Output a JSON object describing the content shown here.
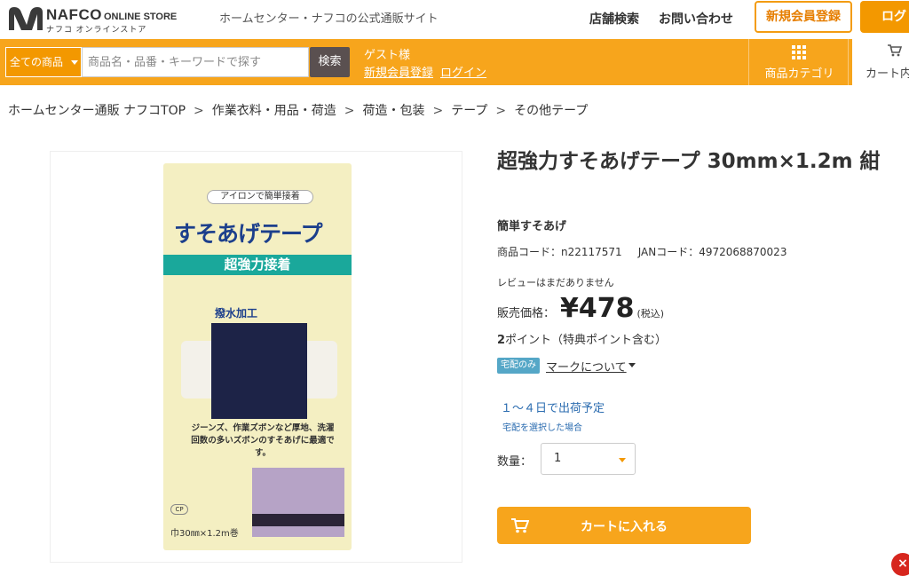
{
  "header": {
    "logo_name": "NAFCO",
    "logo_online": "ONLINE STORE",
    "logo_kana": "ナフコ オンラインストア",
    "tagline": "ホームセンター・ナフコの公式通販サイト",
    "store_search": "店舗検索",
    "contact": "お問い合わせ",
    "register": "新規会員登録",
    "login": "ログ"
  },
  "searchbar": {
    "category_select": "全ての商品",
    "placeholder": "商品名・品番・キーワードで探す",
    "search_button": "検索",
    "guest_label": "ゲスト様",
    "register_link": "新規会員登録",
    "login_link": "ログイン",
    "category_button": "商品カテゴリ",
    "cart_button": "カート内"
  },
  "breadcrumb": [
    "ホームセンター通販 ナフコTOP",
    "作業衣料・用品・荷造",
    "荷造・包装",
    "テープ",
    "その他テープ"
  ],
  "breadcrumb_sep": ">",
  "product_image": {
    "top_label": "アイロンで簡単接着",
    "name": "すそあげテープ",
    "band": "超強力接着",
    "water": "撥水加工",
    "desc": "ジーンズ、作業ズボンなど厚地、洗濯回数の多いズボンのすそあげに最適です。",
    "size": "巾30㎜×1.2m巻",
    "small_logo": "CP"
  },
  "product": {
    "title": "超強力すそあげテープ 30mm×1.2m 紺",
    "subtitle": "簡単すそあげ",
    "code": "商品コード：n22117571",
    "jan": "JANコード：4972068870023",
    "review": "レビューはまだありません",
    "price_label": "販売価格：",
    "price": "¥478",
    "tax": "(税込)",
    "points_num": "2",
    "points_text": "ポイント（特典ポイント含む）",
    "badge": "宅配のみ",
    "mark_link": "マークについて",
    "ship": "１～４日で出荷予定",
    "ship_note": "宅配を選択した場合",
    "qty_label": "数量：",
    "qty_value": "1",
    "add_to_cart": "カートに入れる"
  },
  "colors": {
    "accent": "#f7a51c",
    "dark_button": "#5a5050",
    "link_blue": "#2b6cb0",
    "badge": "#55a7c7"
  }
}
